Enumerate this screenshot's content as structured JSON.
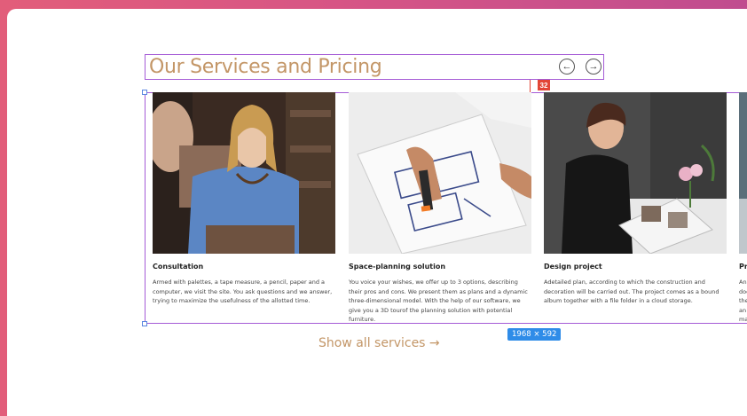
{
  "section": {
    "title": "Our Services and Pricing",
    "prev_icon": "arrow-left-icon",
    "next_icon": "arrow-right-icon",
    "prev_glyph": "←",
    "next_glyph": "→"
  },
  "editor": {
    "spacing_badge": "32",
    "size_badge": "1968 × 592",
    "frame_color": "#a55bd6",
    "badge_color": "#e24636",
    "size_badge_color": "#2f8ce8"
  },
  "cards": [
    {
      "title": "Consultation",
      "text": "Armed with palettes, a tape measure, a pencil, paper and a computer, we visit the site. You ask questions and we answer, trying to maximize the usefulness of the allotted time."
    },
    {
      "title": "Space-planning solution",
      "text": "You voice your wishes, we offer up to 3 options, describing their pros and cons. We present them as plans and a dynamic three-dimensional model. With the help of our software, we give you a 3D tourof the planning solution with potential furniture."
    },
    {
      "title": "Design project",
      "text": "Adetailed plan, according to which the construction and decoration will be carried out. The project comes as a bound album together with a file folder in a cloud storage."
    },
    {
      "title": "Pr",
      "text": "An doc the an ma"
    }
  ],
  "show_all": "Show all services →",
  "colors": {
    "accent": "#c39667",
    "background_gradient": [
      "#e25d7a",
      "#c04d8f"
    ]
  }
}
